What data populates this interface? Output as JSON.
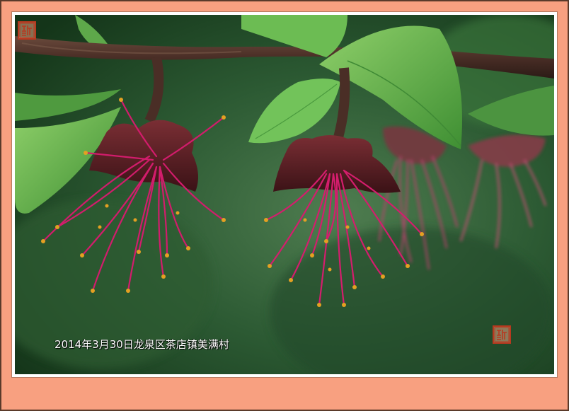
{
  "photo": {
    "caption": "2014年3月30日龙泉区茶店镇美满村",
    "seals": [
      "seal-top",
      "seal-bottom"
    ]
  },
  "colors": {
    "frame": "#f8a080",
    "background_foliage": "#2f5a34",
    "branch": "#4a3028",
    "leaf": "#5fae45",
    "petal": "#5a1e24",
    "stamen": "#d0206a",
    "anther": "#e0a020"
  }
}
